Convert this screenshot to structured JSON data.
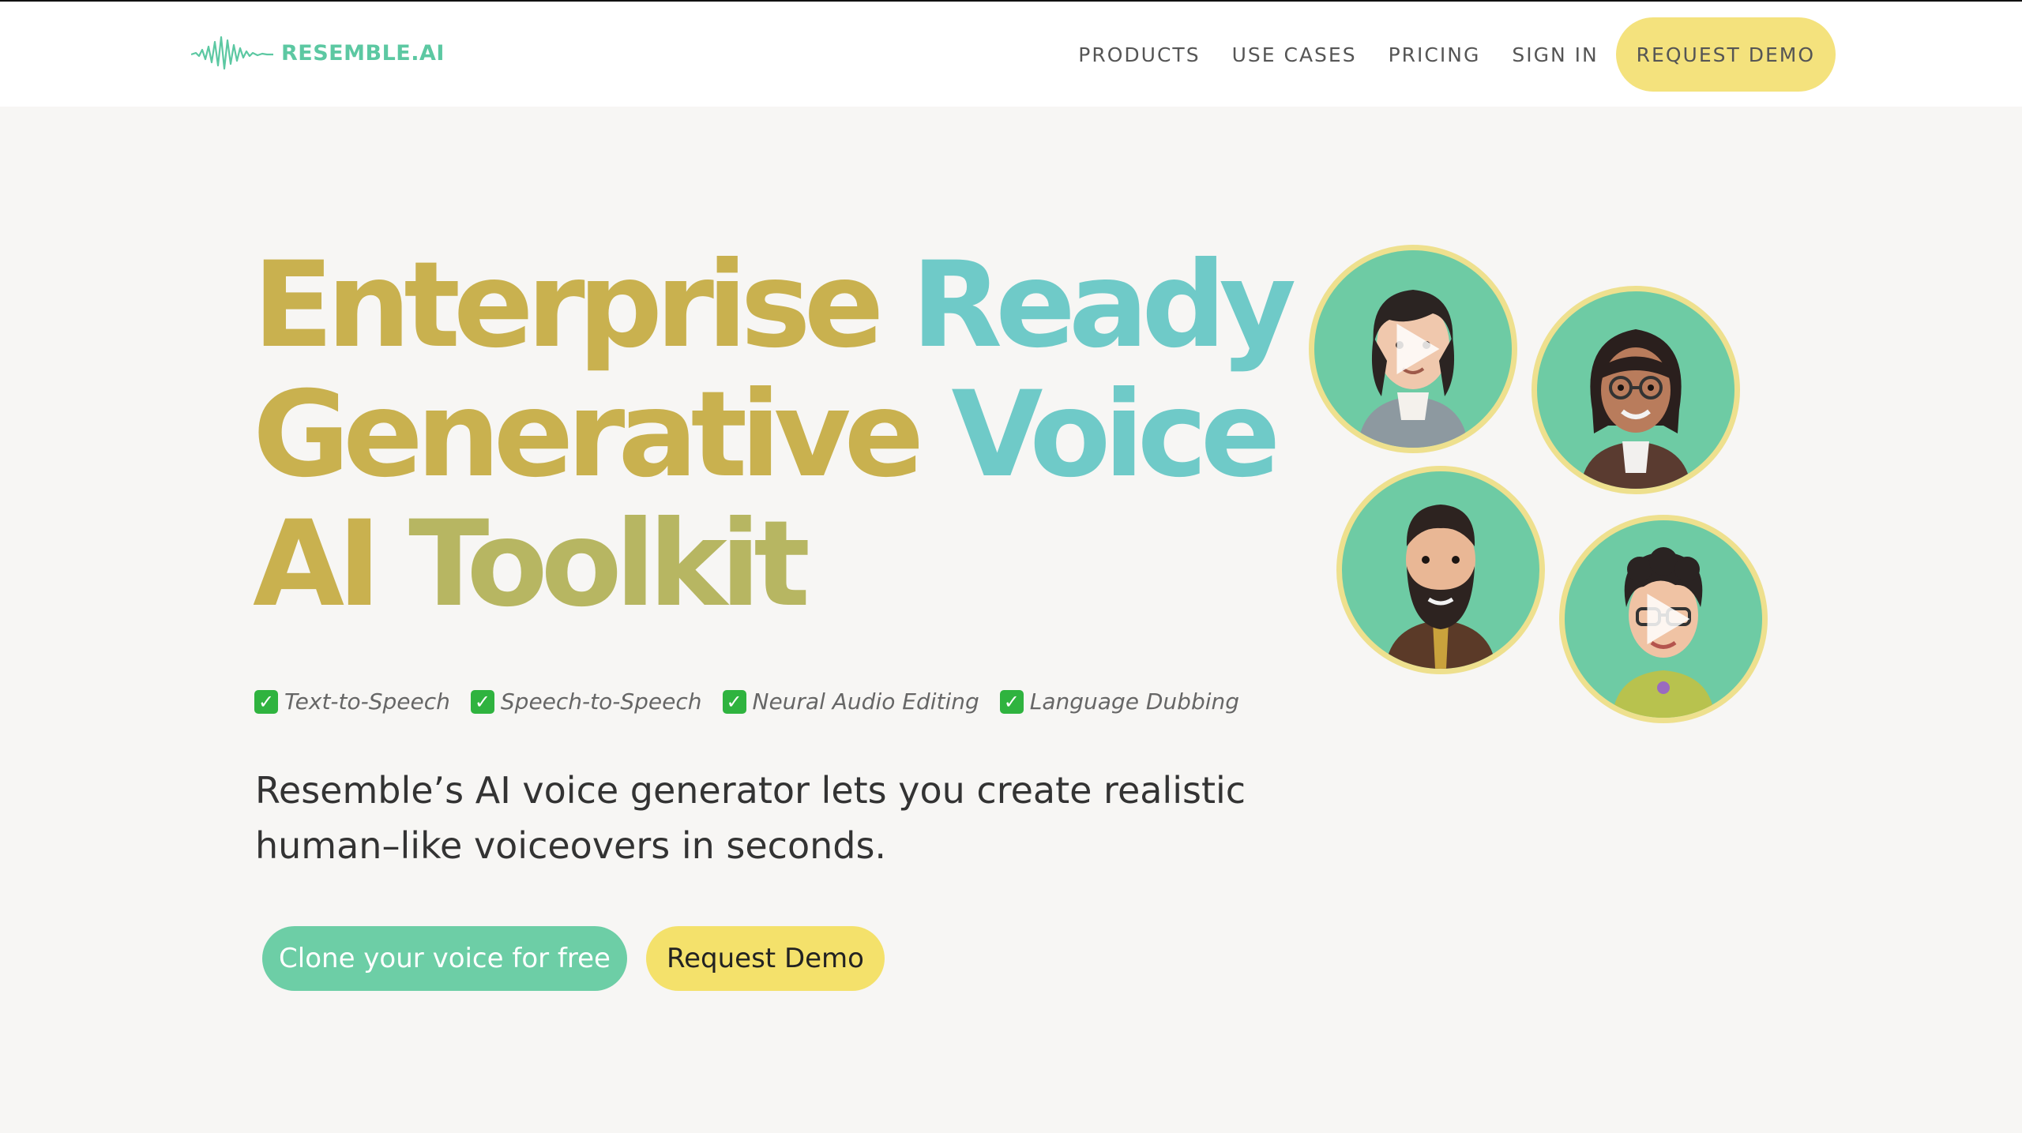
{
  "header": {
    "brand": "RESEMBLE.AI",
    "nav": [
      {
        "label": "PRODUCTS"
      },
      {
        "label": "USE CASES"
      },
      {
        "label": "PRICING"
      },
      {
        "label": "SIGN IN"
      }
    ],
    "cta_label": "REQUEST DEMO"
  },
  "hero": {
    "headline": {
      "line1": [
        "Enterprise",
        "Ready"
      ],
      "line2": [
        "Generative",
        "Voice"
      ],
      "line3": [
        "AI",
        "Toolkit"
      ]
    },
    "features": [
      {
        "label": "Text-to-Speech"
      },
      {
        "label": "Speech-to-Speech"
      },
      {
        "label": "Neural Audio Editing"
      },
      {
        "label": "Language Dubbing"
      }
    ],
    "subtitle_line1": "Resemble’s AI voice generator lets you create realistic",
    "subtitle_line2": "human–like voiceovers in seconds.",
    "primary_button": "Clone your voice for free",
    "secondary_button": "Request Demo"
  },
  "avatars": [
    {
      "icon": "avatar-long-hair-man",
      "has_play": true
    },
    {
      "icon": "avatar-woman-glasses",
      "has_play": false
    },
    {
      "icon": "avatar-bearded-man",
      "has_play": false
    },
    {
      "icon": "avatar-curly-hair-glasses",
      "has_play": true
    }
  ],
  "colors": {
    "brand_green": "#6dcea6",
    "accent_yellow": "#f4e16b",
    "headline_gold": "#c9b14f",
    "headline_cyan": "#73cfdc",
    "background": "#f7f6f4"
  }
}
